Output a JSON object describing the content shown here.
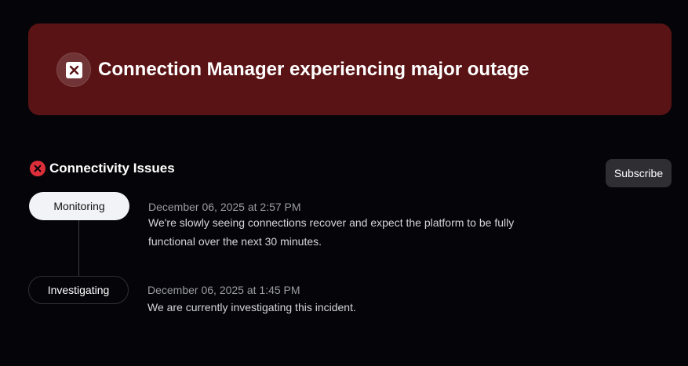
{
  "banner": {
    "title": "Connection Manager experiencing major outage",
    "icon": "close-square-icon",
    "background_color": "#5a1315"
  },
  "incident": {
    "title": "Connectivity Issues",
    "icon": "error-circle-icon",
    "icon_color": "#dc2f3a",
    "subscribe_label": "Subscribe",
    "updates": [
      {
        "status": "Monitoring",
        "timestamp": "December 06, 2025 at 2:57 PM",
        "message": "We're slowly seeing connections recover and expect the platform to be fully functional over the next 30 minutes."
      },
      {
        "status": "Investigating",
        "timestamp": "December 06, 2025 at 1:45 PM",
        "message": "We are currently investigating this incident."
      }
    ]
  }
}
